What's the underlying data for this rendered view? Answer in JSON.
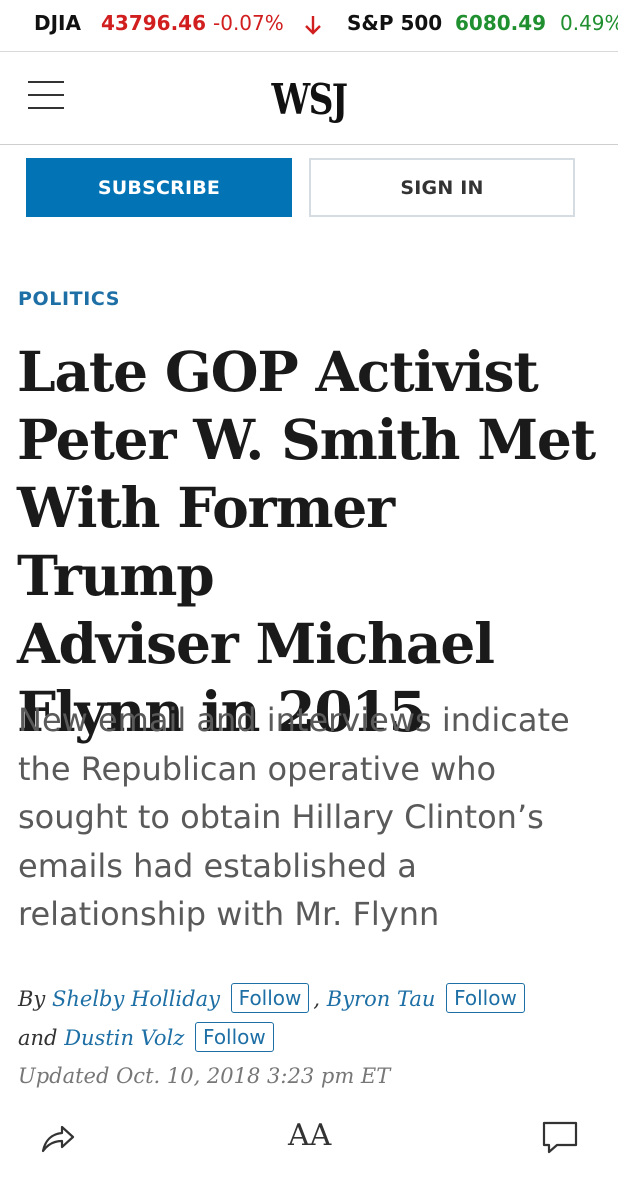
{
  "ticker": [
    {
      "name": "DJIA",
      "value": "43796.46",
      "change": "-0.07%",
      "direction": "down"
    },
    {
      "name": "S&P 500",
      "value": "6080.49",
      "change": "0.49%",
      "direction": "up"
    }
  ],
  "colors": {
    "down": "#d11f1f",
    "up": "#1f8f2f",
    "accent": "#0274b6",
    "link": "#1d6fa5"
  },
  "header": {
    "logo": "WSJ",
    "menu_icon": "hamburger-icon"
  },
  "actions": {
    "subscribe": "SUBSCRIBE",
    "sign_in": "SIGN IN"
  },
  "article": {
    "section": "POLITICS",
    "headline_lines": [
      "Late GOP Activist",
      "Peter W. Smith Met",
      "With Former Trump",
      "Adviser Michael",
      "Flynn in 2015"
    ],
    "dek_lines": [
      "New email and interviews indicate",
      "the Republican operative who",
      "sought to obtain Hillary Clinton’s",
      "emails had established a",
      "relationship with Mr. Flynn"
    ],
    "byline": {
      "by": "By",
      "and": "and",
      "comma": ",",
      "authors": [
        "Shelby Holliday",
        "Byron Tau",
        "Dustin Volz"
      ],
      "follow_label": "Follow"
    },
    "updated": "Updated Oct. 10, 2018 3:23 pm ET"
  },
  "toolbar": {
    "text_size": "AA",
    "icons": [
      "share-icon",
      "text-size-icon",
      "comment-icon"
    ]
  }
}
